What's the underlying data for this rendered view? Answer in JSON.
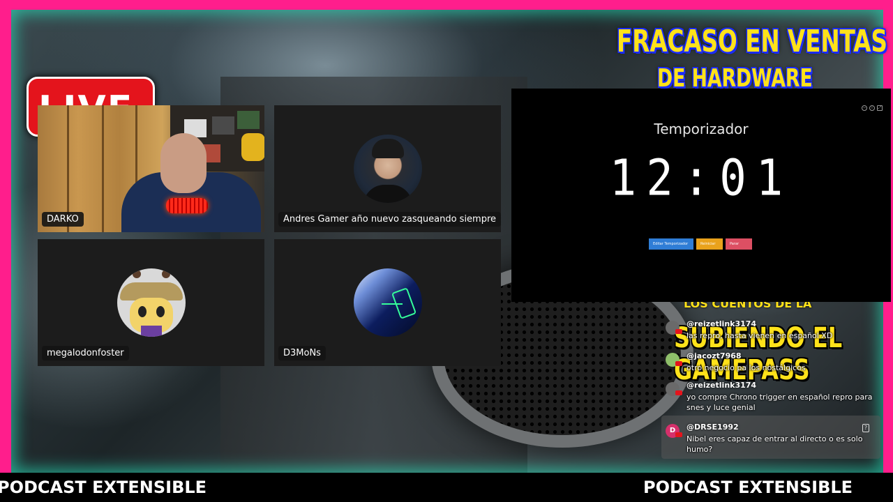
{
  "headlines": {
    "line1": "FRACASO EN VENTAS",
    "line2": "DE HARDWARE",
    "strip": "LOS CUENTOS DE LA LECHERA",
    "line3": "SUBIENDO EL",
    "line4": "GAMEPASS"
  },
  "logo": {
    "text": "LIVE"
  },
  "participants": [
    {
      "name": "DARKO",
      "type": "camera"
    },
    {
      "name": "Andres Gamer año nuevo zasqueando siempre",
      "type": "avatar"
    },
    {
      "name": "megalodonfoster",
      "type": "avatar"
    },
    {
      "name": "D3MoNs",
      "type": "avatar"
    }
  ],
  "timer": {
    "title": "Temporizador",
    "time": "12:01",
    "buttons": {
      "edit": "Editar Temporizador",
      "start": "Reiniciar",
      "stop": "Parar"
    }
  },
  "chat": [
    {
      "user": "@reizetlink3174",
      "text": "las repro, hasta vienen en español XD",
      "avatar_color": "#6a6a6a"
    },
    {
      "user": "@jacozt7968",
      "text": "otro negocio pa los nostálgicos",
      "avatar_color": "#8fbf6a"
    },
    {
      "user": "@reizetlink3174",
      "text": "yo compre Chrono trigger en español repro para snes y luce genial",
      "avatar_color": "#6a6a6a"
    },
    {
      "user": "@DRSE1992",
      "text": "Nibel eres capaz de entrar al directo o es solo humo?",
      "avatar_color": "#d6306b",
      "initial": "D"
    }
  ],
  "ticker": {
    "text": "PODCAST EXTENSIBLE"
  },
  "colors": {
    "frame": "#ff1e8c",
    "headline": "#ffe21a",
    "headline_outline": "#1a2cff",
    "tile": "#1c1c1c"
  }
}
